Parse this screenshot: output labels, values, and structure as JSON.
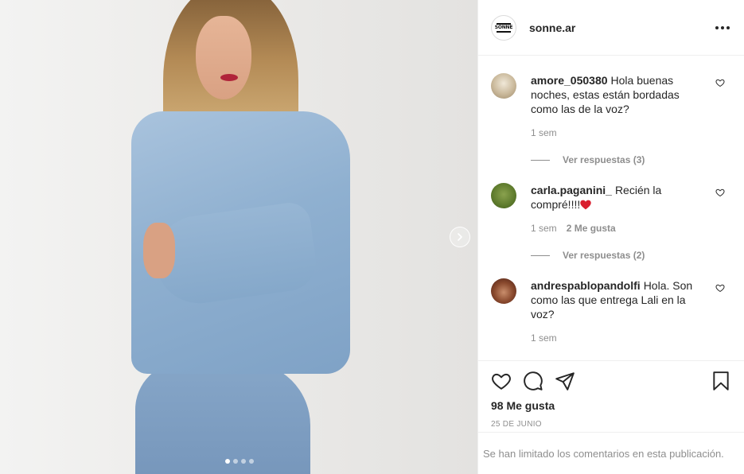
{
  "post": {
    "media": {
      "image_alt_icon": "photo",
      "carousel": {
        "count": 4,
        "active_index": 0
      },
      "next_icon": "chevron-right-icon"
    },
    "header": {
      "avatar_text_top": "SONNE",
      "username": "sonne.ar",
      "more_icon": "more-horizontal-icon"
    },
    "comments": [
      {
        "username": "amore_050380",
        "text": "Hola buenas noches, estas están bordadas como las de la voz?",
        "time": "1 sem",
        "likes": "",
        "replies_label": "Ver respuestas (3)"
      },
      {
        "username": "carla.paganini_",
        "text": "Recién la compré!!!!",
        "emoji": "red-heart",
        "time": "1 sem",
        "likes": "2 Me gusta",
        "replies_label": "Ver respuestas (2)"
      },
      {
        "username": "andrespablopandolfi",
        "text": "Hola. Son como las que entrega Lali en la voz?",
        "time": "1 sem",
        "likes": "",
        "replies_label": ""
      }
    ],
    "actions": {
      "like_icon": "heart-outline-icon",
      "comment_icon": "comment-icon",
      "share_icon": "paper-plane-icon",
      "save_icon": "bookmark-icon",
      "likes_count": "98 Me gusta",
      "date": "25 DE JUNIO"
    },
    "comments_limited_notice": "Se han limitado los comentarios en esta publicación."
  },
  "colors": {
    "text": "#262626",
    "secondary": "#8e8e8e",
    "border": "#efefef",
    "heart_red": "#ed4956"
  }
}
